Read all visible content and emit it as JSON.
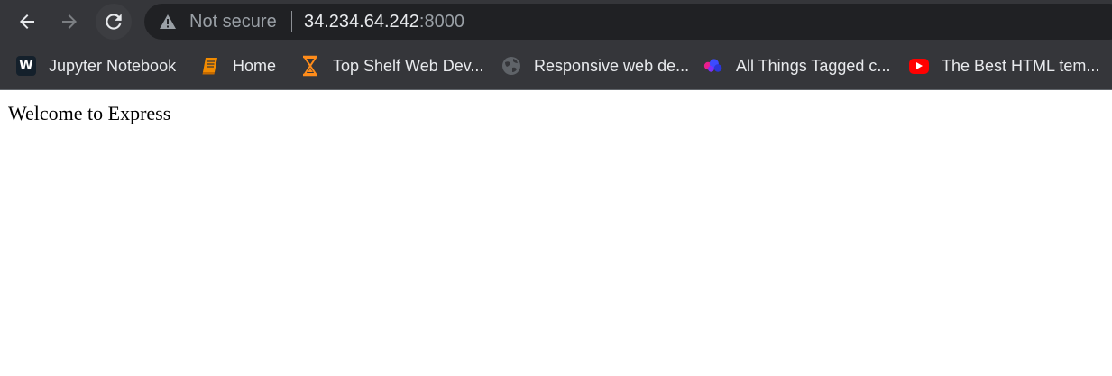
{
  "browser": {
    "security_label": "Not secure",
    "url_host": "34.234.64.242",
    "url_port": ":8000",
    "colors": {
      "chrome_bg": "#35363a",
      "omnibox_bg": "#202124",
      "text": "#e8eaed",
      "muted": "#9aa0a6"
    }
  },
  "bookmarks": [
    {
      "label": "Jupyter Notebook",
      "icon": "w-logo-icon"
    },
    {
      "label": "Home",
      "icon": "book-icon"
    },
    {
      "label": "Top Shelf Web Dev...",
      "icon": "hourglass-icon"
    },
    {
      "label": "Responsive web de...",
      "icon": "globe-icon"
    },
    {
      "label": "All Things Tagged c...",
      "icon": "hearts-icon"
    },
    {
      "label": "The Best HTML tem...",
      "icon": "youtube-icon"
    }
  ],
  "page": {
    "body_text": "Welcome to Express"
  }
}
